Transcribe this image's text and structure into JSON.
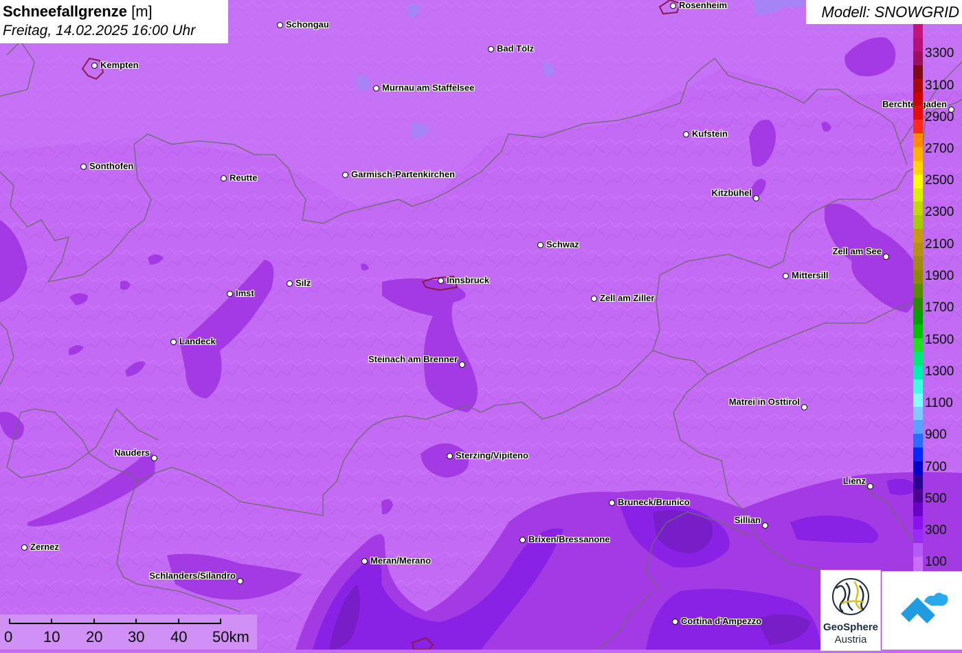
{
  "title": {
    "main": "Schneefallgrenze",
    "unit": "[m]",
    "datetime": "Freitag, 14.02.2025 16:00 Uhr"
  },
  "model": "Modell: SNOWGRID",
  "legend": {
    "labels": [
      "3300",
      "3100",
      "2900",
      "2700",
      "2500",
      "2300",
      "2100",
      "1900",
      "1700",
      "1500",
      "1300",
      "1100",
      "900",
      "700",
      "500",
      "300",
      "100"
    ],
    "colors": [
      "#c2157a",
      "#b5107a",
      "#9c0f5e",
      "#7e0a16",
      "#a80a0a",
      "#cc0000",
      "#e70c0c",
      "#ff2a1a",
      "#ff8c00",
      "#ffb000",
      "#ffd400",
      "#ffff00",
      "#d8f000",
      "#c0d800",
      "#a8c800",
      "#c89a10",
      "#b89010",
      "#a08a10",
      "#8a8a00",
      "#5a8a00",
      "#2a8a00",
      "#00a000",
      "#00c000",
      "#22dd22",
      "#00e87a",
      "#00f0b0",
      "#40ffe0",
      "#80ffff",
      "#80c8ff",
      "#5aa0ff",
      "#2a6cff",
      "#0028ff",
      "#0000c8",
      "#2a0090",
      "#4a0090",
      "#6a00c8",
      "#8a10f0",
      "#9a2af5",
      "#b45af5",
      "#c86ef8"
    ]
  },
  "cities": [
    {
      "name": "Rosenheim"
    },
    {
      "name": "Schongau"
    },
    {
      "name": "Kempten"
    },
    {
      "name": "Bad Tölz"
    },
    {
      "name": "Murnau am Staffelsee"
    },
    {
      "name": "Berchtesgaden"
    },
    {
      "name": "Kufstein"
    },
    {
      "name": "Sonthofen"
    },
    {
      "name": "Reutte"
    },
    {
      "name": "Garmisch-Partenkirchen"
    },
    {
      "name": "Kitzbühel"
    },
    {
      "name": "Schwaz"
    },
    {
      "name": "Zell am See"
    },
    {
      "name": "Imst"
    },
    {
      "name": "Silz"
    },
    {
      "name": "Innsbruck"
    },
    {
      "name": "Mittersill"
    },
    {
      "name": "Zell am Ziller"
    },
    {
      "name": "Landeck"
    },
    {
      "name": "Steinach am Brenner"
    },
    {
      "name": "Matrei in Osttirol"
    },
    {
      "name": "Nauders"
    },
    {
      "name": "Sterzing/Vipiteno"
    },
    {
      "name": "Lienz"
    },
    {
      "name": "Bruneck/Brunico"
    },
    {
      "name": "Sillian"
    },
    {
      "name": "Brixen/Bressanone"
    },
    {
      "name": "Zernez"
    },
    {
      "name": "Meran/Merano"
    },
    {
      "name": "Schlanders/Silandro"
    },
    {
      "name": "Cortina d'Ampezzo"
    }
  ],
  "scale": {
    "labels": [
      "0",
      "10",
      "20",
      "30",
      "40",
      "50km"
    ]
  },
  "logos": {
    "geosphere_line1": "GeoSphere",
    "geosphere_line2": "Austria",
    "snowgrid_icon": "mountain-cloud-icon"
  },
  "colors": {
    "base_fill": "#c36bf5",
    "low_fill": "#a03ae0",
    "deep_fill": "#8a22e6",
    "darkest_fill": "#6a1cb0",
    "border": "#666666"
  }
}
